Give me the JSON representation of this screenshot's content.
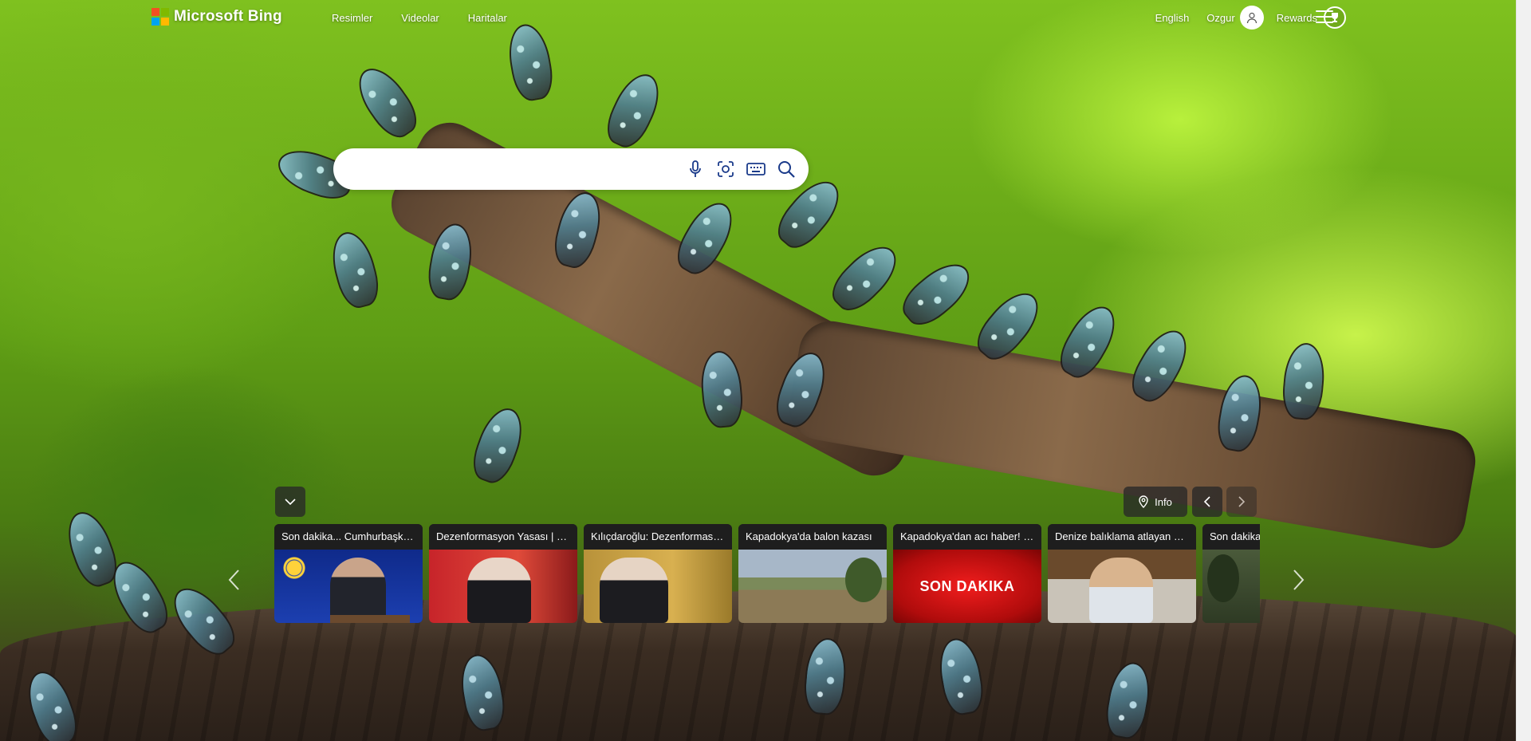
{
  "brand": {
    "name": "Microsoft Bing",
    "logo_colors": [
      "#f25022",
      "#7fba00",
      "#00a4ef",
      "#ffb900"
    ]
  },
  "nav": [
    "Resimler",
    "Videolar",
    "Haritalar"
  ],
  "header_right": {
    "language": "English",
    "user_name": "Ozgur",
    "rewards_label": "Rewards"
  },
  "search": {
    "value": "",
    "placeholder": "",
    "icons": [
      "microphone-icon",
      "visual-search-icon",
      "keyboard-icon",
      "search-icon"
    ]
  },
  "carousel": {
    "info_label": "Info",
    "cards": [
      {
        "title": "Son dakika... Cumhurbaşkanı Erdoğan",
        "thumb": "erdogan"
      },
      {
        "title": "Dezenformasyon Yasası | Canlı",
        "thumb": "kilicdaroglu-1"
      },
      {
        "title": "Kılıçdaroğlu: Dezenformasyon",
        "thumb": "kilicdaroglu-2"
      },
      {
        "title": "Kapadokya'da balon kazası",
        "thumb": "field"
      },
      {
        "title": "Kapadokya'dan acı haber! Son",
        "thumb": "son-dakika"
      },
      {
        "title": "Denize balıklama atlayan Hasan",
        "thumb": "young-man"
      },
      {
        "title": "Son dakika",
        "thumb": "outdoor"
      }
    ],
    "son_dakika_text": "SON DAKIKA"
  }
}
